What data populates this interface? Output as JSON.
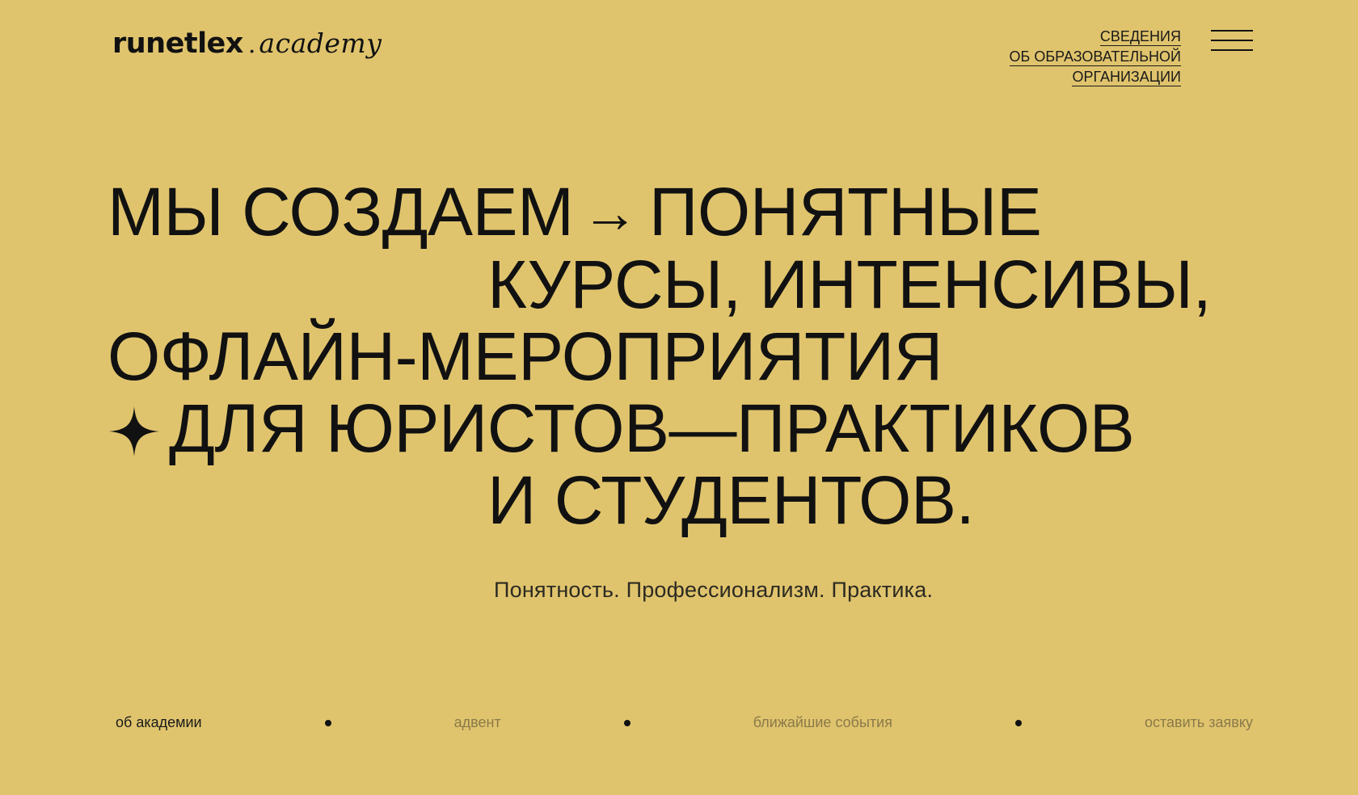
{
  "header": {
    "logo_main": "runetlex",
    "logo_dot": ".",
    "logo_sub": "academy",
    "org_link_lines": [
      "СВЕДЕНИЯ",
      "ОБ ОБРАЗОВАТЕЛЬНОЙ",
      "ОРГАНИЗАЦИИ"
    ],
    "menu_icon": "hamburger-icon"
  },
  "hero": {
    "line1_a": "МЫ СОЗДАЕМ",
    "arrow": "→",
    "line1_b": "ПОНЯТНЫЕ",
    "line2": "КУРСЫ, ИНТЕНСИВЫ,",
    "line3": "ОФЛАЙН-МЕРОПРИЯТИЯ",
    "line4": "ДЛЯ ЮРИСТОВ—ПРАКТИКОВ",
    "line5": "И СТУДЕНТОВ.",
    "star_icon": "four-point-star-icon"
  },
  "tagline": "Понятность. Профессионализм. Практика.",
  "bottom_nav": {
    "items": [
      {
        "label": "об академии",
        "active": true
      },
      {
        "label": "адвент",
        "active": false
      },
      {
        "label": "ближайшие события",
        "active": false
      },
      {
        "label": "оставить заявку",
        "active": false
      }
    ]
  },
  "colors": {
    "background": "#e0c46d",
    "text": "#111111",
    "muted_nav": "#8a7a4a"
  }
}
